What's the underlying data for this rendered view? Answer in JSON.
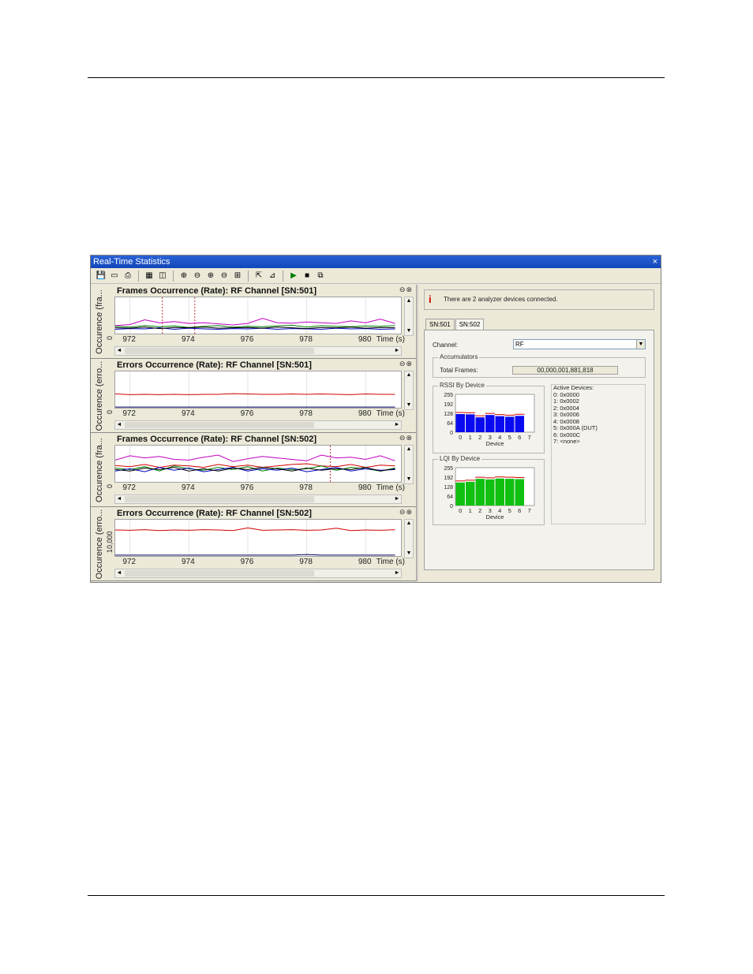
{
  "window": {
    "title": "Real-Time Statistics",
    "close_glyph": "×"
  },
  "toolbar": {
    "buttons": [
      {
        "name": "save-icon",
        "glyph": "💾"
      },
      {
        "name": "open-icon",
        "glyph": "▭"
      },
      {
        "name": "print-icon",
        "glyph": "⎙"
      },
      {
        "name": "grid-icon",
        "glyph": "▦"
      },
      {
        "name": "layout-icon",
        "glyph": "◫"
      },
      {
        "name": "zoom-in-icon",
        "glyph": "⊕"
      },
      {
        "name": "zoom-out-icon",
        "glyph": "⊖"
      },
      {
        "name": "zoom-x-icon",
        "glyph": "⊕"
      },
      {
        "name": "zoom-y-icon",
        "glyph": "⊖"
      },
      {
        "name": "zoom-fit-icon",
        "glyph": "⊞"
      },
      {
        "name": "export-icon",
        "glyph": "⇱"
      },
      {
        "name": "chart-icon",
        "glyph": "⊿"
      },
      {
        "name": "play-icon",
        "glyph": "▶"
      },
      {
        "name": "stop-icon",
        "glyph": "■"
      },
      {
        "name": "reset-icon",
        "glyph": "⧉"
      }
    ]
  },
  "panels": [
    {
      "title": "Frames Occurrence (Rate): RF Channel [SN:501]",
      "ylabel": "Occurence (fra...",
      "ytick": "0",
      "scroll_up": "▲",
      "scroll_down": "▼"
    },
    {
      "title": "Errors Occurrence (Rate): RF Channel [SN:501]",
      "ylabel": "Occurence (erro...",
      "ytick": "0",
      "scroll_up": "▲",
      "scroll_down": "▼"
    },
    {
      "title": "Frames Occurrence (Rate): RF Channel [SN:502]",
      "ylabel": "Occurence (fra...",
      "ytick": "0",
      "scroll_up": "▲",
      "scroll_down": "▼"
    },
    {
      "title": "Errors Occurrence (Rate): RF Channel [SN:502]",
      "ylabel": "Occurence (erro...",
      "ytick": "10,000",
      "scroll_up": "▲",
      "scroll_down": "▼"
    }
  ],
  "panel_icons": "⊖⊗",
  "x_axis": {
    "ticks": [
      "972",
      "974",
      "976",
      "978",
      "980"
    ],
    "unit": "Time (s)",
    "scroll_left": "◄",
    "scroll_right": "►"
  },
  "colors": {
    "red": "#d00000",
    "magenta": "#c000c0",
    "blue": "#0000c0",
    "green": "#008000",
    "black": "#000000",
    "navy": "#000060",
    "bar_rssi": "#0a0af0",
    "bar_lqi": "#10c010"
  },
  "right": {
    "info_icon": "i",
    "info_text": "There are 2 analyzer devices connected.",
    "tabs": [
      "SN:501",
      "SN:502"
    ],
    "active_tab": "SN:502",
    "channel_label": "Channel:",
    "channel_value": "RF",
    "dropdown_glyph": "▼",
    "accumulators_title": "Accumulators",
    "total_frames_label": "Total Frames:",
    "total_frames_value": "00,000,001,881,818",
    "rssi_title": "RSSI By Device",
    "lqi_title": "LQI By Device",
    "bar_yticks": [
      "255",
      "192",
      "128",
      "64",
      "0"
    ],
    "bar_xticks": [
      "0",
      "1",
      "2",
      "3",
      "4",
      "5",
      "6",
      "7"
    ],
    "bar_xlabel": "Device",
    "active_devices_title": "Active Devices:",
    "active_devices": [
      "0: 0x0000",
      "1: 0x0002",
      "2: 0x0004",
      "3: 0x0006",
      "4: 0x0008",
      "5: 0x000A (DUT)",
      "6: 0x000C",
      "7: <none>"
    ]
  },
  "chart_data": [
    {
      "type": "line",
      "title": "Frames Occurrence (Rate): RF Channel [SN:501]",
      "xlabel": "Time (s)",
      "ylabel": "Occurence (fra...",
      "x": [
        971.5,
        972,
        972.5,
        973,
        973.5,
        974,
        974.5,
        975,
        975.5,
        976,
        976.5,
        977,
        977.5,
        978,
        978.5,
        979,
        979.5,
        980,
        980.5,
        981
      ],
      "ylim": [
        0,
        100
      ],
      "series": [
        {
          "color": "magenta",
          "values": [
            22,
            25,
            38,
            30,
            33,
            28,
            30,
            27,
            24,
            28,
            42,
            30,
            29,
            32,
            30,
            28,
            35,
            30,
            40,
            28
          ]
        },
        {
          "color": "green",
          "values": [
            20,
            18,
            22,
            19,
            21,
            17,
            20,
            22,
            18,
            20,
            19,
            21,
            23,
            18,
            22,
            20,
            19,
            21,
            20,
            22
          ]
        },
        {
          "color": "blue",
          "values": [
            12,
            14,
            13,
            16,
            12,
            15,
            13,
            12,
            14,
            13,
            15,
            12,
            14,
            13,
            12,
            15,
            13,
            14,
            12,
            13
          ]
        },
        {
          "color": "black",
          "values": [
            16,
            15,
            18,
            14,
            17,
            16,
            18,
            15,
            16,
            17,
            15,
            18,
            16,
            14,
            17,
            16,
            18,
            15,
            17,
            16
          ]
        }
      ],
      "markers_x": [
        973.1,
        974.2
      ]
    },
    {
      "type": "line",
      "title": "Errors Occurrence (Rate): RF Channel [SN:501]",
      "xlabel": "Time (s)",
      "ylabel": "Occurence (erro...",
      "x": [
        971.5,
        972,
        972.5,
        973,
        973.5,
        974,
        974.5,
        975,
        975.5,
        976,
        976.5,
        977,
        977.5,
        978,
        978.5,
        979,
        979.5,
        980,
        980.5,
        981
      ],
      "ylim": [
        0,
        100
      ],
      "series": [
        {
          "color": "red",
          "values": [
            38,
            36,
            37,
            36,
            37,
            36,
            37,
            37,
            39,
            38,
            37,
            37,
            38,
            37,
            38,
            37,
            36,
            38,
            37,
            37
          ]
        },
        {
          "color": "navy",
          "values": [
            2,
            2,
            2,
            2,
            2,
            2,
            2,
            2,
            2,
            2,
            2,
            2,
            2,
            2,
            2,
            2,
            2,
            2,
            2,
            2
          ]
        }
      ]
    },
    {
      "type": "line",
      "title": "Frames Occurrence (Rate): RF Channel [SN:502]",
      "xlabel": "Time (s)",
      "ylabel": "Occurence (fra...",
      "x": [
        971.5,
        972,
        972.5,
        973,
        973.5,
        974,
        974.5,
        975,
        975.5,
        976,
        976.5,
        977,
        977.5,
        978,
        978.5,
        979,
        979.5,
        980,
        980.5,
        981
      ],
      "ylim": [
        0,
        100
      ],
      "series": [
        {
          "color": "magenta",
          "values": [
            60,
            72,
            66,
            70,
            62,
            60,
            68,
            74,
            56,
            64,
            70,
            66,
            62,
            58,
            74,
            66,
            68,
            62,
            72,
            58
          ]
        },
        {
          "color": "red",
          "values": [
            45,
            42,
            48,
            40,
            46,
            44,
            40,
            48,
            42,
            46,
            40,
            44,
            48,
            50,
            44,
            42,
            48,
            40,
            46,
            44
          ]
        },
        {
          "color": "green",
          "values": [
            38,
            34,
            42,
            30,
            44,
            36,
            32,
            40,
            34,
            42,
            30,
            38,
            34,
            36,
            44,
            32,
            40,
            36,
            30,
            38
          ]
        },
        {
          "color": "blue",
          "values": [
            30,
            36,
            28,
            40,
            32,
            38,
            28,
            34,
            40,
            30,
            36,
            32,
            38,
            28,
            34,
            40,
            30,
            36,
            32,
            34
          ]
        },
        {
          "color": "black",
          "values": [
            34,
            30,
            38,
            34,
            40,
            30,
            36,
            30,
            38,
            34,
            40,
            36,
            30,
            38,
            32,
            36,
            34,
            40,
            30,
            36
          ]
        }
      ],
      "markers_x": [
        978.8
      ]
    },
    {
      "type": "line",
      "title": "Errors Occurrence (Rate): RF Channel [SN:502]",
      "xlabel": "Time (s)",
      "ylabel": "Occurence (erro...",
      "x": [
        971.5,
        972,
        972.5,
        973,
        973.5,
        974,
        974.5,
        975,
        975.5,
        976,
        976.5,
        977,
        977.5,
        978,
        978.5,
        979,
        979.5,
        980,
        980.5,
        981
      ],
      "ylim": [
        0,
        12000
      ],
      "series": [
        {
          "color": "red",
          "values": [
            8600,
            8500,
            8700,
            8400,
            8600,
            8500,
            8700,
            8600,
            8400,
            9300,
            8500,
            8600,
            8700,
            8500,
            8600,
            9200,
            8400,
            8600,
            8500,
            8700
          ]
        },
        {
          "color": "navy",
          "values": [
            300,
            300,
            300,
            300,
            300,
            300,
            300,
            300,
            300,
            300,
            300,
            300,
            300,
            500,
            300,
            300,
            300,
            300,
            300,
            300
          ]
        }
      ]
    },
    {
      "type": "bar",
      "title": "RSSI By Device",
      "xlabel": "Device",
      "categories": [
        "0",
        "1",
        "2",
        "3",
        "4",
        "5",
        "6",
        "7"
      ],
      "values": [
        122,
        120,
        100,
        116,
        108,
        104,
        110,
        0
      ],
      "ylim": [
        0,
        255
      ]
    },
    {
      "type": "bar",
      "title": "LQI By Device",
      "xlabel": "Device",
      "categories": [
        "0",
        "1",
        "2",
        "3",
        "4",
        "5",
        "6",
        "7"
      ],
      "values": [
        155,
        160,
        180,
        176,
        182,
        180,
        178,
        0
      ],
      "ylim": [
        0,
        255
      ]
    }
  ]
}
